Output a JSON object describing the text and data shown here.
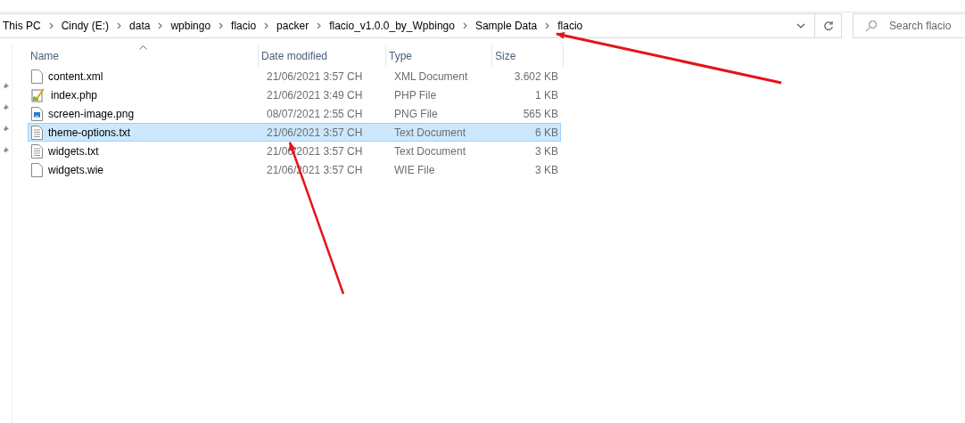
{
  "breadcrumb": [
    {
      "label": "This PC"
    },
    {
      "label": "Cindy (E:)"
    },
    {
      "label": "data"
    },
    {
      "label": "wpbingo"
    },
    {
      "label": "flacio"
    },
    {
      "label": "packer"
    },
    {
      "label": "flacio_v1.0.0_by_Wpbingo"
    },
    {
      "label": "Sample Data"
    },
    {
      "label": "flacio"
    }
  ],
  "search": {
    "placeholder": "Search flacio"
  },
  "columns": [
    {
      "label": "Name",
      "sorted": true
    },
    {
      "label": "Date modified",
      "sorted": false
    },
    {
      "label": "Type",
      "sorted": false
    },
    {
      "label": "Size",
      "sorted": false
    }
  ],
  "files": [
    {
      "name": "content.xml",
      "date": "21/06/2021 3:57 CH",
      "type": "XML Document",
      "size": "3.602 KB",
      "kind": "blank",
      "selected": false
    },
    {
      "name": "index.php",
      "date": "21/06/2021 3:49 CH",
      "type": "PHP File",
      "size": "1 KB",
      "kind": "script",
      "selected": false
    },
    {
      "name": "screen-image.png",
      "date": "08/07/2021 2:55 CH",
      "type": "PNG File",
      "size": "565 KB",
      "kind": "image",
      "selected": false
    },
    {
      "name": "theme-options.txt",
      "date": "21/06/2021 3:57 CH",
      "type": "Text Document",
      "size": "6 KB",
      "kind": "text",
      "selected": true
    },
    {
      "name": "widgets.txt",
      "date": "21/06/2021 3:57 CH",
      "type": "Text Document",
      "size": "3 KB",
      "kind": "text",
      "selected": false
    },
    {
      "name": "widgets.wie",
      "date": "21/06/2021 3:57 CH",
      "type": "WIE File",
      "size": "3 KB",
      "kind": "blank",
      "selected": false
    }
  ]
}
